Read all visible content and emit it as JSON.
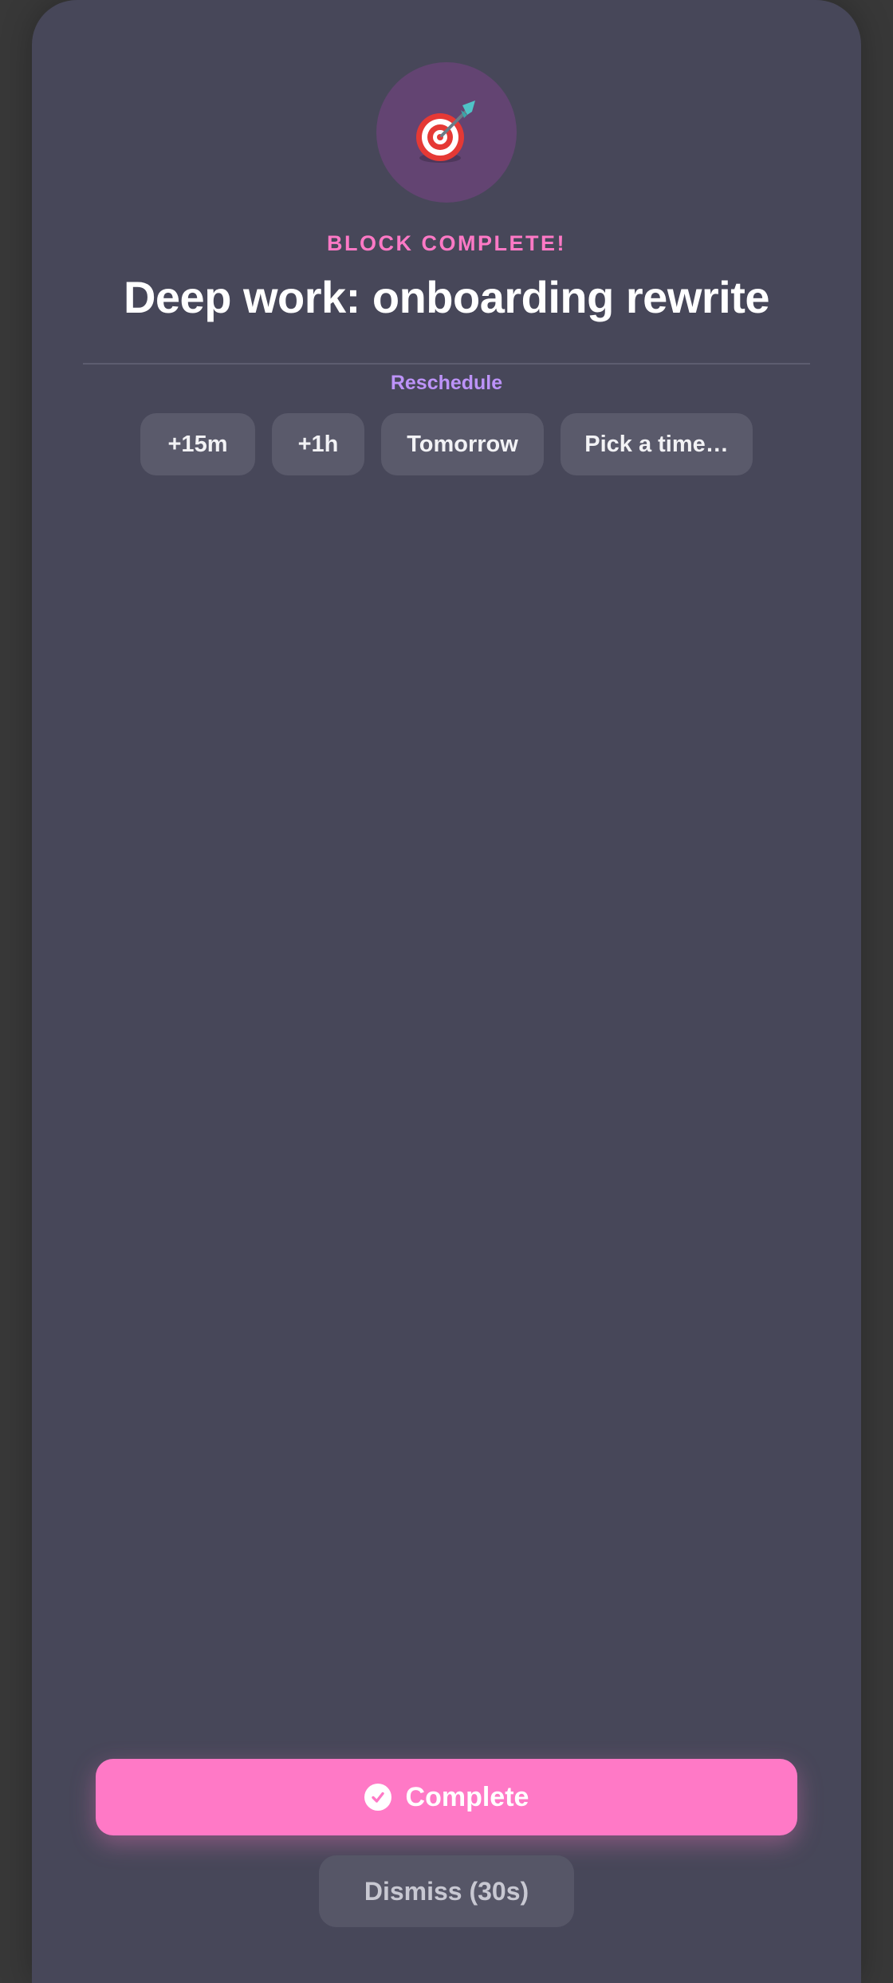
{
  "header": {
    "icon": "dart-target-icon",
    "eyebrow": "BLOCK COMPLETE!",
    "title": "Deep work: onboarding rewrite"
  },
  "reschedule": {
    "label": "Reschedule",
    "options": [
      "+15m",
      "+1h",
      "Tomorrow",
      "Pick a time…"
    ]
  },
  "actions": {
    "complete_label": "Complete",
    "complete_icon": "check-circle-icon",
    "dismiss_label": "Dismiss (30s)"
  },
  "colors": {
    "background": "#383838",
    "card": "#474759",
    "accent_pink": "#ff79c6",
    "accent_purple": "#bd93f9",
    "icon_circle": "#634472",
    "chip": "#5a5a6b"
  }
}
